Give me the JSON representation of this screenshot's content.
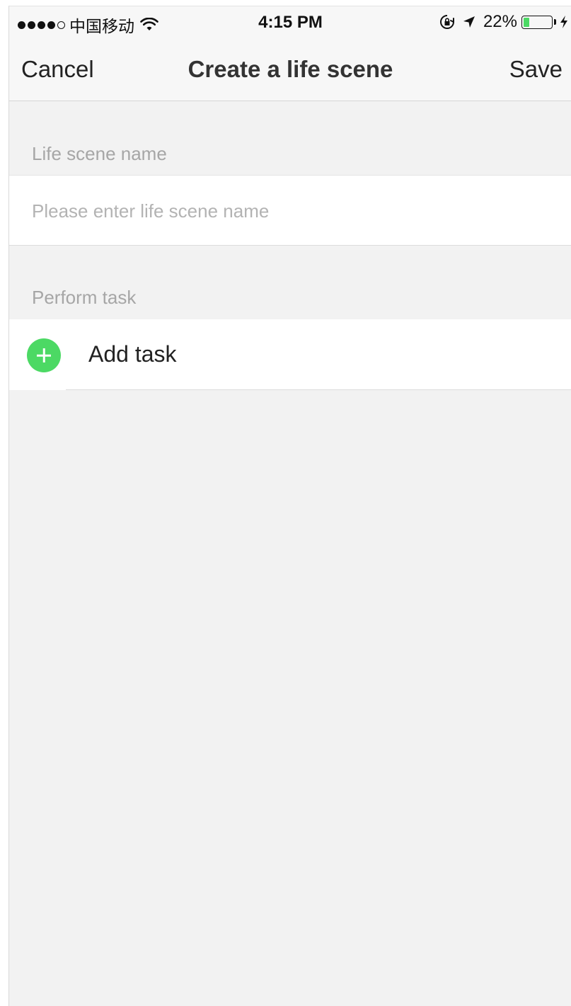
{
  "status_bar": {
    "carrier": "中国移动",
    "time": "4:15 PM",
    "battery_percent": "22%",
    "battery_level": 0.22,
    "signal_bars_filled": 4,
    "signal_bars_total": 5,
    "icons": [
      "wifi-icon",
      "orientation-lock-icon",
      "location-arrow-icon",
      "battery-icon",
      "charging-bolt-icon"
    ]
  },
  "nav": {
    "cancel_label": "Cancel",
    "title": "Create a life scene",
    "save_label": "Save"
  },
  "sections": {
    "name": {
      "header": "Life scene name",
      "placeholder": "Please enter life scene name",
      "value": ""
    },
    "task": {
      "header": "Perform task",
      "add_label": "Add task",
      "add_icon": "plus-circle-icon"
    }
  },
  "colors": {
    "accent_green": "#4cd964",
    "background": "#f2f2f2",
    "header_text": "#a6a6a6",
    "placeholder_text": "#b3b3b3"
  }
}
